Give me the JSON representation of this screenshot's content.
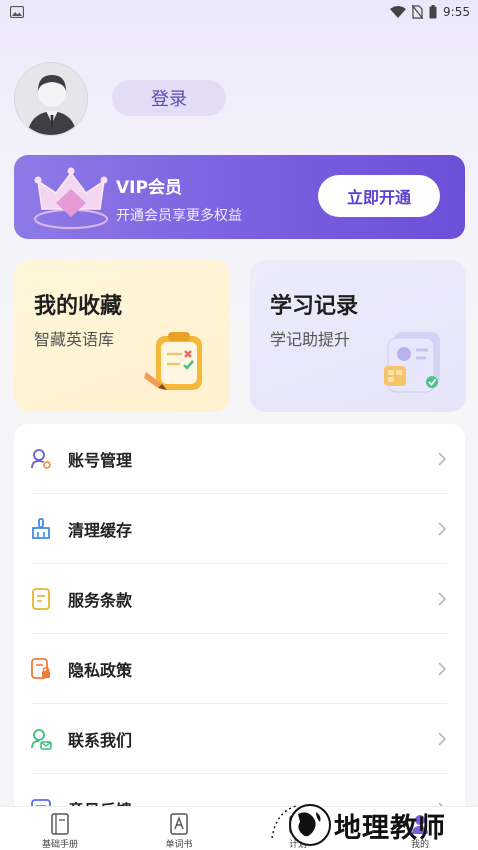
{
  "status_bar": {
    "time": "9:55"
  },
  "header": {
    "login_label": "登录"
  },
  "vip": {
    "title": "VIP会员",
    "subtitle": "开通会员享更多权益",
    "button_label": "立即开通"
  },
  "cards": {
    "favorites": {
      "title": "我的收藏",
      "subtitle": "智藏英语库"
    },
    "study_record": {
      "title": "学习记录",
      "subtitle": "学记助提升"
    }
  },
  "menu": {
    "items": [
      {
        "label": "账号管理",
        "icon": "account-icon",
        "color": "#6c5bd6"
      },
      {
        "label": "清理缓存",
        "icon": "broom-icon",
        "color": "#3f8fe0"
      },
      {
        "label": "服务条款",
        "icon": "document-icon",
        "color": "#e8b52a"
      },
      {
        "label": "隐私政策",
        "icon": "privacy-icon",
        "color": "#f07a3a"
      },
      {
        "label": "联系我们",
        "icon": "contact-icon",
        "color": "#3bbf7a"
      },
      {
        "label": "意见反馈",
        "icon": "feedback-icon",
        "color": "#5b6cf0"
      }
    ]
  },
  "tabbar": {
    "tabs": [
      {
        "label": "基础手册",
        "icon": "handbook-icon"
      },
      {
        "label": "单词书",
        "icon": "wordbook-icon"
      },
      {
        "label": "计划",
        "icon": "plan-icon"
      },
      {
        "label": "我的",
        "icon": "profile-icon"
      }
    ]
  },
  "watermark": {
    "text": "地理教师"
  },
  "colors": {
    "accent": "#7a5fe0",
    "vip_button_text": "#5b3fcf",
    "login_bg": "#e2dcf5"
  }
}
